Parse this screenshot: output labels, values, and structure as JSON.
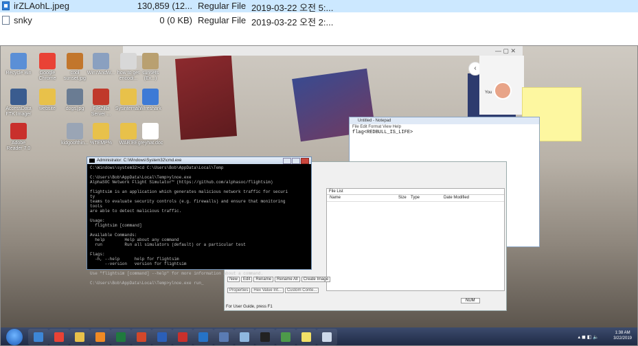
{
  "explorer": {
    "rows": [
      {
        "name": "irZLAohL.jpeg",
        "size": "130,859 (12...",
        "type": "Regular File",
        "date": "2019-03-22 오전 5:...",
        "icon": "jpeg-file-icon"
      },
      {
        "name": "snky",
        "size": "0 (0 KB)",
        "type": "Regular File",
        "date": "2019-03-22 오전 2:...",
        "icon": "blank-file-icon"
      }
    ]
  },
  "desktop_icons": [
    {
      "label": "Recycle Bin",
      "color": "#5b8fd6"
    },
    {
      "label": "Google Chrome",
      "color": "#e94235"
    },
    {
      "label": "cool sunset.jpg",
      "color": "#c2762c"
    },
    {
      "label": "Win7AndW...",
      "color": "#8aa0c0"
    },
    {
      "label": "how to get encodi...",
      "color": "#d8d8d8"
    },
    {
      "label": "sunsets (Ex...)",
      "color": "#b9a070"
    },
    {
      "label": "AccessData FTK Imager",
      "color": "#3a5c8f"
    },
    {
      "label": "website",
      "color": "#e8c14a"
    },
    {
      "label": "dogs.jpg",
      "color": "#6a7c93"
    },
    {
      "label": "FileZilla Server ...",
      "color": "#c0392b"
    },
    {
      "label": "Sysinternals",
      "color": "#e8c14a"
    },
    {
      "label": "Wireshark",
      "color": "#3d7ad6"
    },
    {
      "label": "Adobe Reader 7.0",
      "color": "#c9302c"
    },
    {
      "label": "kidgoofthin...",
      "color": "#9aa5b5"
    },
    {
      "label": "%TEMP%",
      "color": "#e8c14a"
    },
    {
      "label": "WAB.EE",
      "color": "#e8c14a"
    },
    {
      "label": "greyhat.doc",
      "color": "#ffffff"
    }
  ],
  "notepad": {
    "title": "Untitled - Notepad",
    "menu": "File  Edit  Format  View  Help",
    "content": "flag<REDBULL_IS_LIFE>"
  },
  "filelist_app": {
    "panel_title": "File List",
    "columns": [
      "Name",
      "Size",
      "Type",
      "Date Modified"
    ],
    "buttons": [
      "New",
      "Edit",
      "Rename",
      "Rename All",
      "Create Image"
    ],
    "props_tabs": [
      "Properties",
      "Hex Value Int...",
      "Custom Conte..."
    ],
    "status": "For User Guide, press F1",
    "num": "NUM"
  },
  "cmd": {
    "title": "Administrator: C:\\Windows\\System32\\cmd.exe",
    "lines": [
      "C:\\Windows\\system32>cd C:\\Users\\Bob\\AppData\\Local\\Temp",
      "",
      "C:\\Users\\Bob\\AppData\\Local\\Temp>ylnoe.exe",
      "AlphaSOC Network Flight Simulator™ (https://github.com/alphasoc/flightsim)",
      "",
      "flightsim is an application which generates malicious network traffic for securi",
      "ty",
      "teams to evaluate security controls (e.g. firewalls) and ensure that monitoring",
      "tools",
      "are able to detect malicious traffic.",
      "",
      "Usage:",
      "  flightsim [command]",
      "",
      "Available Commands:",
      "  help        Help about any command",
      "  run         Run all simulators (default) or a particular test",
      "",
      "Flags:",
      "  -h, --help      help for flightsim",
      "      --version   version for flightsim",
      "",
      "Use \"flightsim [command] --help\" for more information about a command.",
      "",
      "C:\\Users\\Bob\\AppData\\Local\\Temp>ylnoe.exe run_"
    ]
  },
  "browser": {
    "you_label": "You"
  },
  "taskbar": {
    "time": "1:38 AM",
    "date": "3/22/2019",
    "apps": [
      {
        "name": "ie",
        "color": "#3d86d6"
      },
      {
        "name": "chrome",
        "color": "#e94235"
      },
      {
        "name": "explorer",
        "color": "#e8c14a"
      },
      {
        "name": "media",
        "color": "#f08a24"
      },
      {
        "name": "excel",
        "color": "#1f7a3e"
      },
      {
        "name": "powerpoint",
        "color": "#d2472a"
      },
      {
        "name": "word",
        "color": "#2b5fb8"
      },
      {
        "name": "adobe",
        "color": "#c9302c"
      },
      {
        "name": "outlook",
        "color": "#2673c7"
      },
      {
        "name": "ftk",
        "color": "#5a7bb3"
      },
      {
        "name": "notepad",
        "color": "#8fb8e0"
      },
      {
        "name": "cmd",
        "color": "#222222"
      },
      {
        "name": "network",
        "color": "#4d9a4a"
      },
      {
        "name": "sticky",
        "color": "#f2e067"
      },
      {
        "name": "files",
        "color": "#cdd9ea"
      }
    ]
  }
}
